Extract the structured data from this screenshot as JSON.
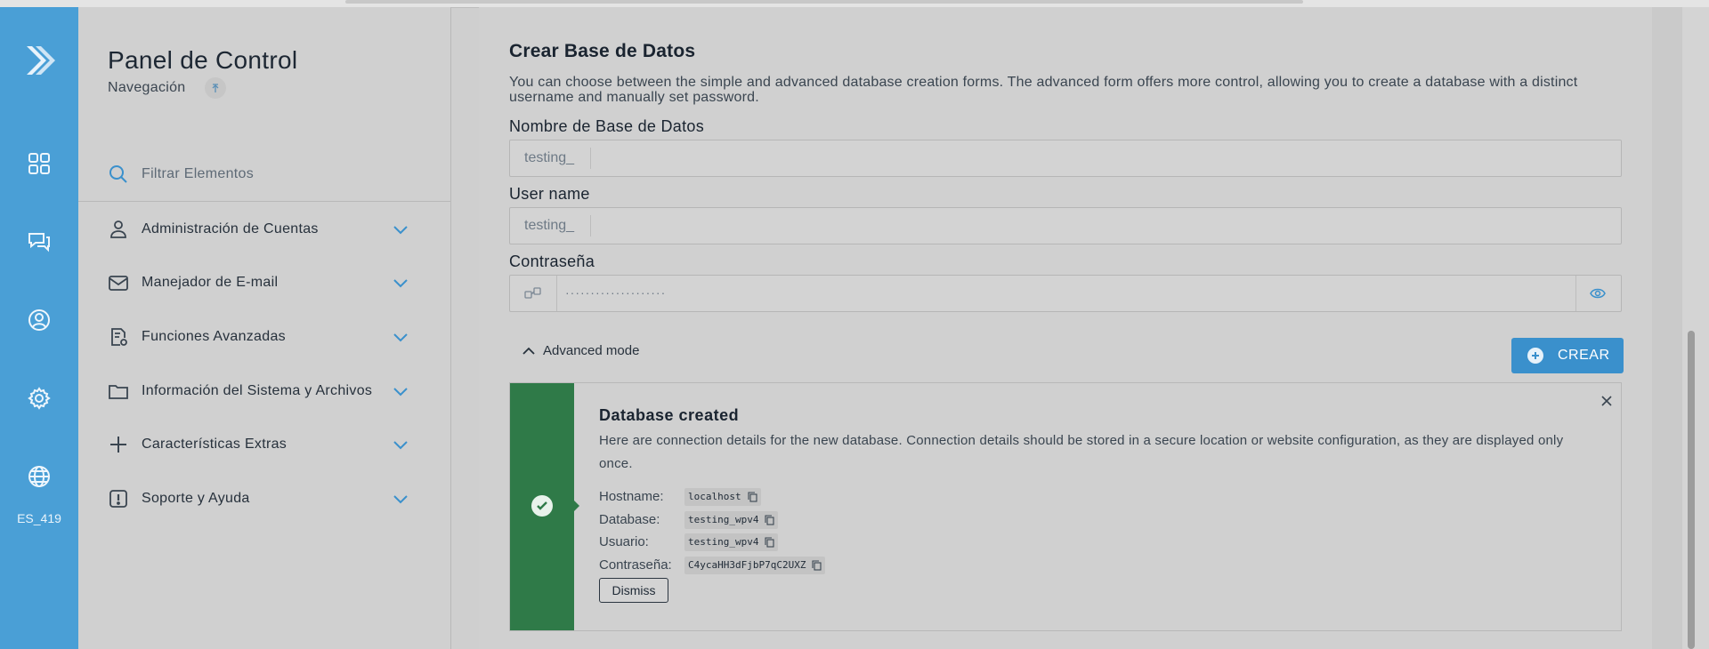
{
  "rail": {
    "icons": [
      "logo-icon",
      "dashboard-grid-icon",
      "chat-icon",
      "account-icon",
      "settings-gear-icon",
      "globe-icon"
    ],
    "language": "ES_419"
  },
  "sidebar": {
    "title": "Panel de Control",
    "subtitle": "Navegación",
    "search_placeholder": "Filtrar Elementos",
    "items": [
      {
        "label": "Administración de Cuentas",
        "icon": "user-icon"
      },
      {
        "label": "Manejador de E-mail",
        "icon": "mail-icon"
      },
      {
        "label": "Funciones Avanzadas",
        "icon": "advanced-settings-icon"
      },
      {
        "label": "Información del Sistema y Archivos",
        "icon": "folder-icon"
      },
      {
        "label": "Características Extras",
        "icon": "plus-icon"
      },
      {
        "label": "Soporte y Ayuda",
        "icon": "alert-icon"
      }
    ]
  },
  "main": {
    "title": "Crear Base de Datos",
    "description": "You can choose between the simple and advanced database creation forms. The advanced form offers more control, allowing you to create a database with a distinct username and manually set password.",
    "db_name_label": "Nombre de Base de Datos",
    "db_name_prefix": "testing_",
    "db_name_value": "",
    "user_label": "User name",
    "user_prefix": "testing_",
    "user_value": "",
    "password_label": "Contraseña",
    "password_masked": "····················",
    "advanced_toggle": "Advanced mode",
    "create_button": "CREAR"
  },
  "alert": {
    "title": "Database created",
    "message": "Here are connection details for the new database. Connection details should be stored in a secure location or website configuration, as they are displayed only once.",
    "details": [
      {
        "key": "Hostname:",
        "value": "localhost"
      },
      {
        "key": "Database:",
        "value": "testing_wpv4"
      },
      {
        "key": "Usuario:",
        "value": "testing_wpv4"
      },
      {
        "key": "Contraseña:",
        "value": "C4ycaHH3dFjbP7qC2UXZ"
      }
    ],
    "dismiss_label": "Dismiss"
  },
  "colors": {
    "rail": "#4a9fd6",
    "accent": "#3a90cc",
    "success": "#2f7a48",
    "background": "#d0d0d0"
  }
}
